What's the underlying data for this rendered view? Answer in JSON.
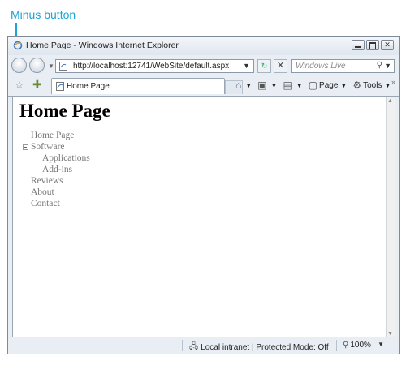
{
  "annotation": {
    "label": "Minus button",
    "color": "#1aa4d8"
  },
  "window": {
    "title": "Home Page - Windows Internet Explorer",
    "address": "http://localhost:12741/WebSite/default.aspx",
    "search_placeholder": "Windows Live"
  },
  "tab": {
    "label": "Home Page"
  },
  "command_bar": {
    "items": [
      {
        "icon": "home-icon",
        "label": ""
      },
      {
        "icon": "feeds-icon",
        "label": ""
      },
      {
        "icon": "print-icon",
        "label": ""
      },
      {
        "icon": "page-icon",
        "label": "Page"
      },
      {
        "icon": "tools-icon",
        "label": "Tools"
      }
    ]
  },
  "page": {
    "heading": "Home Page",
    "menu": [
      {
        "label": "Home Page",
        "level": 1
      },
      {
        "label": "Software",
        "level": 1,
        "expanded": true
      },
      {
        "label": "Applications",
        "level": 2
      },
      {
        "label": "Add-ins",
        "level": 2
      },
      {
        "label": "Reviews",
        "level": 1
      },
      {
        "label": "About",
        "level": 1
      },
      {
        "label": "Contact",
        "level": 1
      }
    ]
  },
  "status": {
    "zone": "Local intranet | Protected Mode: Off",
    "zoom": "100%"
  }
}
